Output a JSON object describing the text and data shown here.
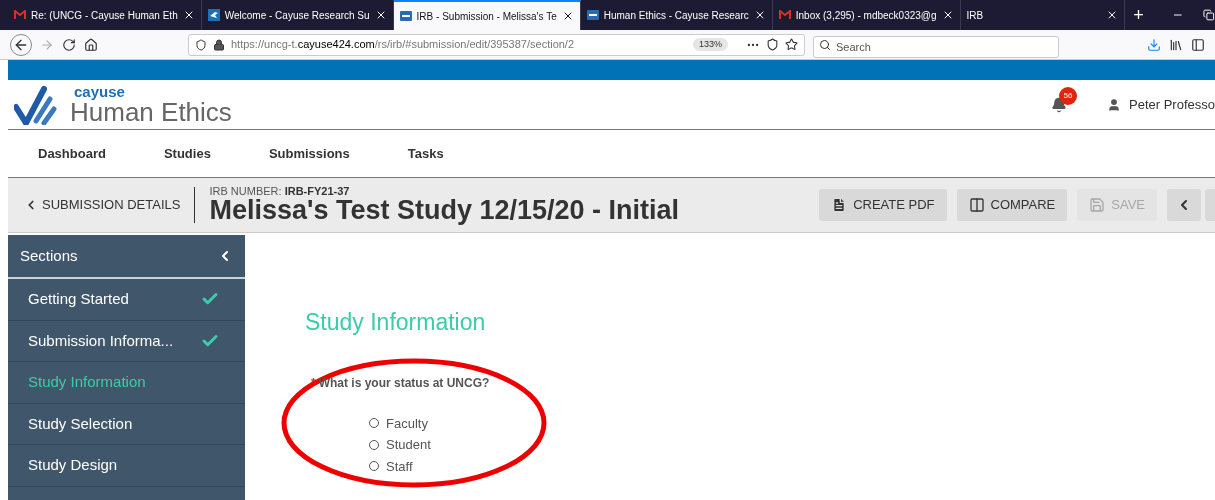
{
  "browser": {
    "tabs": [
      {
        "title": "Re: (UNCG - Cayuse Human Eth",
        "selected": false
      },
      {
        "title": "Welcome - Cayuse Research Su",
        "selected": false
      },
      {
        "title": "IRB - Submission - Melissa's Te",
        "selected": true
      },
      {
        "title": "Human Ethics - Cayuse Researc",
        "selected": false
      },
      {
        "title": "Inbox (3,295) - mdbeck0323@g",
        "selected": false
      },
      {
        "title": "IRB",
        "selected": false
      }
    ],
    "new_tab": "+",
    "url_host_prefix": "https://uncg-t.",
    "url_host": "cayuse424.com",
    "url_path": "/rs/irb/#submission/edit/395387/section/2",
    "zoom": "133%",
    "search": {
      "placeholder": "Search"
    }
  },
  "app": {
    "logo_small": "cayuse",
    "logo_large": "Human Ethics",
    "notifications": "56",
    "user": "Peter Professo",
    "nav": [
      "Dashboard",
      "Studies",
      "Submissions",
      "Tasks"
    ],
    "back_link": "SUBMISSION DETAILS",
    "irb_label": "IRB NUMBER:",
    "irb_number": "IRB-FY21-37",
    "title": "Melissa's Test Study 12/15/20 - Initial",
    "actions": [
      {
        "label": "CREATE PDF",
        "kind": "pdf",
        "disabled": false
      },
      {
        "label": "COMPARE",
        "kind": "compare",
        "disabled": false
      },
      {
        "label": "SAVE",
        "kind": "save",
        "disabled": true
      }
    ]
  },
  "sidebar": {
    "title": "Sections",
    "items": [
      {
        "label": "Getting Started",
        "complete": true,
        "selected": false
      },
      {
        "label": "Submission Informa...",
        "complete": true,
        "selected": false
      },
      {
        "label": "Study Information",
        "complete": false,
        "selected": true
      },
      {
        "label": "Study Selection",
        "complete": false,
        "selected": false
      },
      {
        "label": "Study Design",
        "complete": false,
        "selected": false
      }
    ]
  },
  "form": {
    "heading": "Study Information",
    "required_mark": "*",
    "question": "What is your status at UNCG?",
    "options": [
      {
        "label": "Faculty",
        "selected": false
      },
      {
        "label": "Student",
        "selected": false
      },
      {
        "label": "Staff",
        "selected": false
      }
    ]
  }
}
